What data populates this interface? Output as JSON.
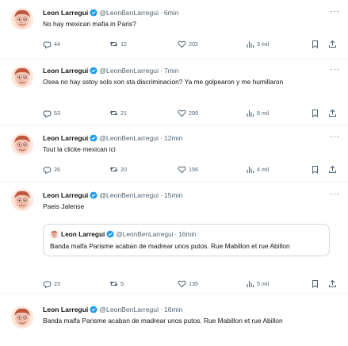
{
  "tweets": [
    {
      "name": "Leon Larregui",
      "handle": "@LeonBenLarregui",
      "time": "6min",
      "text": "No hay mexican mafia in Paris?",
      "replies": "44",
      "retweets": "12",
      "likes": "202",
      "views": "3 mil"
    },
    {
      "name": "Leon Larregui",
      "handle": "@LeonBenLarregui",
      "time": "7min",
      "text": "Osea no hay sstoy solo xon sta discriminacion? Ya me golpearon y me humillaron",
      "replies": "53",
      "retweets": "21",
      "likes": "299",
      "views": "8 mil"
    },
    {
      "name": "Leon Larregui",
      "handle": "@LeonBenLarregui",
      "time": "12min",
      "text": "Tout la clicke  mexican ici",
      "replies": "26",
      "retweets": "20",
      "likes": "156",
      "views": "4 mil"
    },
    {
      "name": "Leon Larregui",
      "handle": "@LeonBenLarregui",
      "time": "15min",
      "text": "Paeis Jalense",
      "quote": {
        "name": "Leon Larregui",
        "handle": "@LeonBenLarregui",
        "time": "16min",
        "text": "Banda malfa Parisme acaban de madrear unos putos. Rue Mabillon et rue Abillon"
      },
      "replies": "23",
      "retweets": "5",
      "likes": "135",
      "views": "5 mil"
    },
    {
      "name": "Leon Larregui",
      "handle": "@LeonBenLarregui",
      "time": "16min",
      "text": "Banda malfa Parisme acaban de madrear unos putos. Rue Mabillon et rue Abillon"
    }
  ],
  "dot": "·",
  "more": "···",
  "colors": {
    "verified": "#1d9bf0",
    "muted": "#536471",
    "divider": "#eff3f4",
    "avatar_bg": "#fde7dd",
    "avatar_face": "#e8a48c"
  },
  "icons": [
    "reply-icon",
    "retweet-icon",
    "like-icon",
    "views-icon",
    "bookmark-icon",
    "share-icon",
    "verified-badge-icon",
    "more-icon"
  ]
}
